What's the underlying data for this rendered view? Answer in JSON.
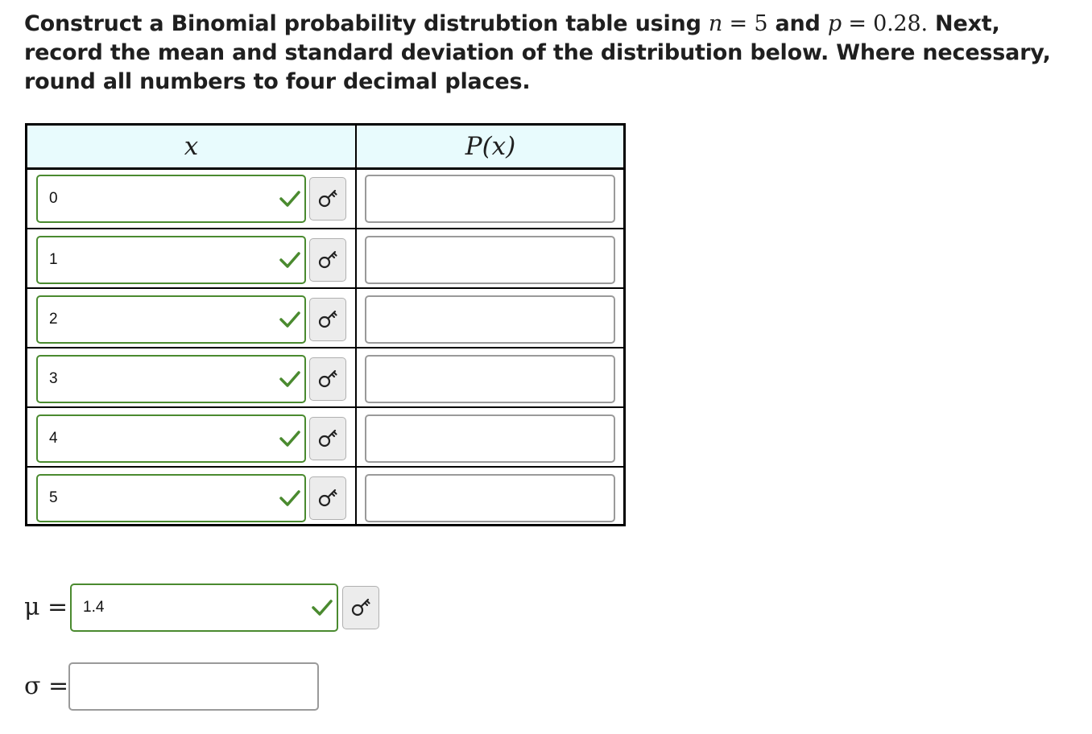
{
  "question": {
    "part1": "Construct a Binomial probability distrubtion table using ",
    "n_var": "n",
    "eq1": " = 5",
    "and": " and ",
    "p_var": "p",
    "eq2": " = 0.28.",
    "part2": " Next, record the mean and standard deviation of the distribution below. Where necessary, round all numbers to four decimal places."
  },
  "table": {
    "col_x_header": "x",
    "col_p_header": "P(x)",
    "rows": [
      {
        "x": "0",
        "x_status": "correct",
        "p": ""
      },
      {
        "x": "1",
        "x_status": "correct",
        "p": ""
      },
      {
        "x": "2",
        "x_status": "correct",
        "p": ""
      },
      {
        "x": "3",
        "x_status": "correct",
        "p": ""
      },
      {
        "x": "4",
        "x_status": "correct",
        "p": ""
      },
      {
        "x": "5",
        "x_status": "correct",
        "p": ""
      }
    ]
  },
  "mean": {
    "label": "μ =",
    "value": "1.4",
    "status": "correct"
  },
  "std": {
    "label": "σ =",
    "value": ""
  },
  "icons": {
    "check": "check-icon",
    "key": "key-icon"
  },
  "colors": {
    "correct": "#4a8a2f",
    "header_bg": "#e8fbfd",
    "empty_border": "#9a9a9a",
    "key_bg": "#ececec"
  }
}
